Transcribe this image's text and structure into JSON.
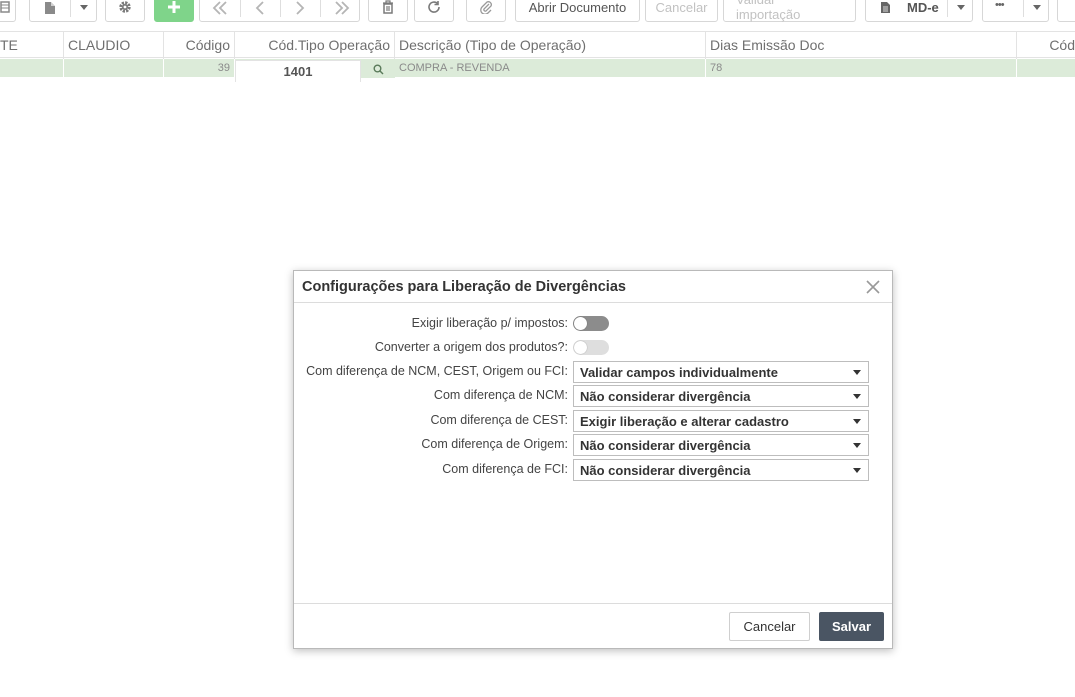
{
  "toolbar": {
    "abrir_documento": "Abrir Documento",
    "cancelar": "Cancelar",
    "validar_importacao": "Validar importação",
    "mde": "MD-e",
    "more": "•••",
    "accent_green": "#7fd48a"
  },
  "grid": {
    "headers": [
      "TE",
      "CLAUDIO",
      "Código",
      "Cód.Tipo Operação",
      "Descrição (Tipo de Operação)",
      "Dias Emissão Doc",
      "Cód"
    ],
    "row": {
      "codigo": "39",
      "cod_tipo_operacao": "1401",
      "descricao": "COMPRA - REVENDA",
      "dias_emissao": "78"
    },
    "row_color": "#dcebd9"
  },
  "modal": {
    "title": "Configurações para Liberação de Divergências",
    "fields": {
      "exigir_liberacao": {
        "label": "Exigir liberação p/ impostos:",
        "on": false
      },
      "converter_origem": {
        "label": "Converter a origem dos produtos?:",
        "on": false,
        "disabled": true
      },
      "dif_ncm_cest_origem_fci": {
        "label": "Com diferença de NCM, CEST, Origem ou FCI:",
        "value": "Validar campos individualmente"
      },
      "dif_ncm": {
        "label": "Com diferença de NCM:",
        "value": "Não considerar divergência"
      },
      "dif_cest": {
        "label": "Com diferença de CEST:",
        "value": "Exigir liberação e alterar cadastro"
      },
      "dif_origem": {
        "label": "Com diferença de Origem:",
        "value": "Não considerar divergência"
      },
      "dif_fci": {
        "label": "Com diferença de FCI:",
        "value": "Não considerar divergência"
      }
    },
    "buttons": {
      "cancel": "Cancelar",
      "save": "Salvar"
    },
    "save_color": "#4a5563"
  }
}
